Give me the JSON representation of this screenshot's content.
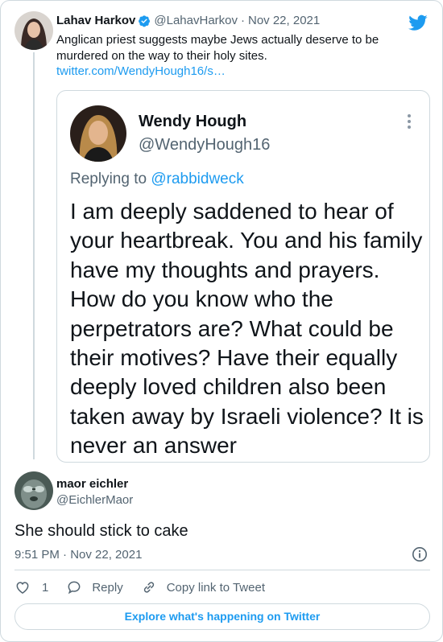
{
  "parent_tweet": {
    "author_name": "Lahav Harkov",
    "author_handle": "@LahavHarkov",
    "separator": "·",
    "date": "Nov 22, 2021",
    "text": "Anglican priest suggests maybe Jews actually deserve to be murdered on the way to their holy sites.",
    "link": "twitter.com/WendyHough16/s…",
    "icon": "twitter-bird-icon",
    "verified_icon": "verified-badge-icon"
  },
  "quoted_screenshot": {
    "author_name": "Wendy Hough",
    "author_handle": "@WendyHough16",
    "more_icon": "vertical-ellipsis-icon",
    "replying_prefix": "Replying to",
    "replying_mention": "@rabbidweck",
    "text": "I am deeply saddened to hear of your heartbreak. You and his family have my thoughts and prayers. How do you know who the perpetrators are? What could be their motives? Have their equally deeply loved children also been taken away by Israeli violence? It is never an answer"
  },
  "main_tweet": {
    "author_name": "maor eichler",
    "author_handle": "@EichlerMaor",
    "text": "She should stick to cake",
    "timestamp": "9:51 PM · Nov 22, 2021",
    "info_icon": "info-icon"
  },
  "actions": {
    "like_count": "1",
    "reply_label": "Reply",
    "copy_label": "Copy link to Tweet"
  },
  "explore_label": "Explore what's happening on Twitter",
  "colors": {
    "accent": "#1d9bf0",
    "text": "#0f1419",
    "muted": "#536471",
    "border": "#cfd9de"
  }
}
